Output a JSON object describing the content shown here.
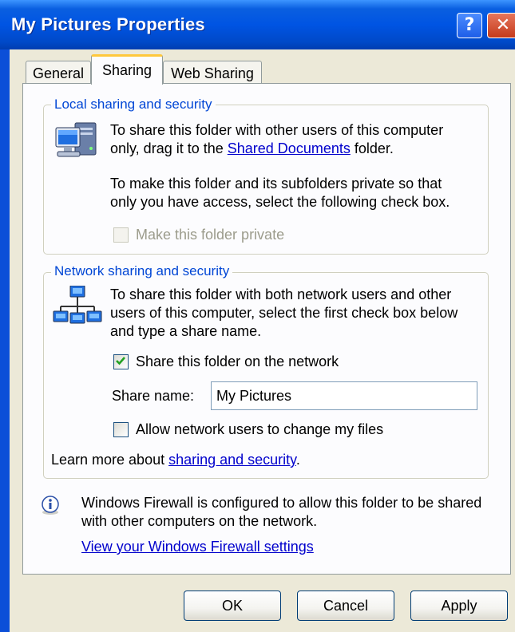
{
  "window": {
    "title": "My Pictures Properties",
    "help_glyph": "?",
    "close_glyph": "✕"
  },
  "tabs": [
    {
      "label": "General",
      "selected": false
    },
    {
      "label": "Sharing",
      "selected": true
    },
    {
      "label": "Web Sharing",
      "selected": false
    }
  ],
  "local": {
    "legend": "Local sharing and security",
    "line1": "To share this folder with other users of this computer",
    "line2_prefix": "only, drag it to the ",
    "line2_link": "Shared Documents",
    "line2_suffix": " folder.",
    "line3": "To make this folder and its subfolders private so that",
    "line4": "only you have access, select the following check box.",
    "private_checkbox_label": "Make this folder private",
    "private_checked": false,
    "private_enabled": false
  },
  "network": {
    "legend": "Network sharing and security",
    "line1": "To share this folder with both network users and other",
    "line2": "users of this computer, select the first check box below",
    "line3": "and type a share name.",
    "share_checkbox_label": "Share this folder on the network",
    "share_checked": true,
    "share_name_label": "Share name:",
    "share_name_value": "My Pictures",
    "allow_change_label": "Allow network users to change my files",
    "allow_change_checked": false,
    "learn_prefix": "Learn more about ",
    "learn_link": "sharing and security",
    "learn_suffix": "."
  },
  "firewall": {
    "line1": "Windows Firewall is configured to allow this folder to be shared",
    "line2": "with other computers on the network.",
    "link": "View your Windows Firewall settings"
  },
  "buttons": {
    "ok": "OK",
    "cancel": "Cancel",
    "apply": "Apply"
  },
  "colors": {
    "titlebar": "#0054E3",
    "dialog_bg": "#ECE9D8",
    "tab_page_bg": "#FCFCFE",
    "legend_text": "#0046D5",
    "link": "#0000CC",
    "selected_tab_accent": "#FFC83C"
  }
}
